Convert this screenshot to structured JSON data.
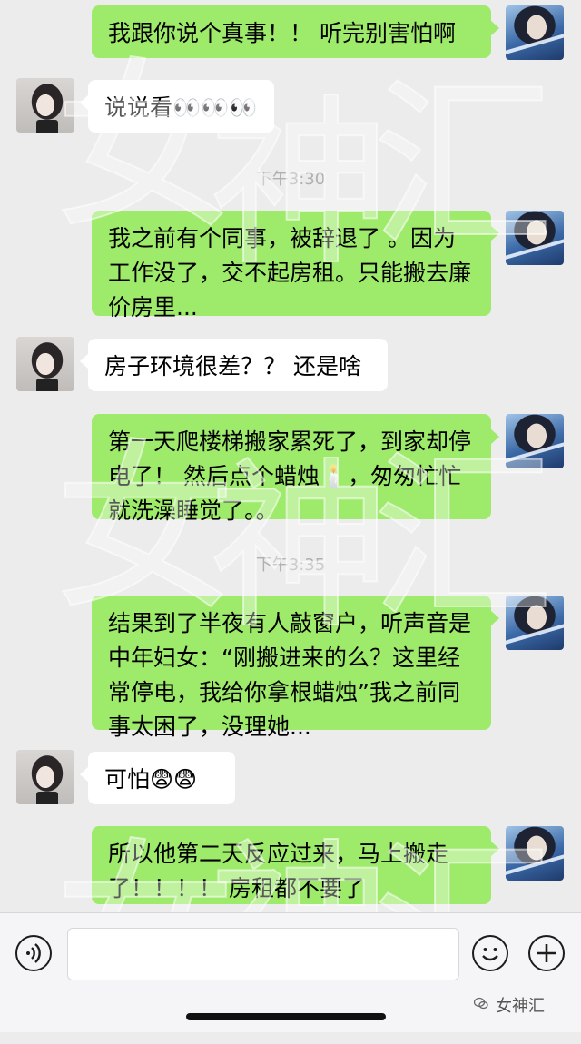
{
  "messages": [
    {
      "side": "me",
      "text": "我跟你说个真事！！ 听完别害怕啊"
    },
    {
      "side": "them",
      "text": "说说看👀👀👀"
    },
    {
      "time": "下午3:30"
    },
    {
      "side": "me",
      "text": "我之前有个同事，被辞退了 。因为工作没了，交不起房租。只能搬去廉价房里..."
    },
    {
      "side": "them",
      "text": "房子环境很差？？ 还是啥"
    },
    {
      "side": "me",
      "text": "第一天爬楼梯搬家累死了，到家却停电了！ 然后点个蜡烛🕯️，匆匆忙忙就洗澡睡觉了。。"
    },
    {
      "time": "下午3:35"
    },
    {
      "side": "me",
      "text": "结果到了半夜有人敲窗户，听声音是中年妇女：“刚搬进来的么？这里经常停电，我给你拿根蜡烛”我之前同事太困了，没理她..."
    },
    {
      "side": "them",
      "text": "可怕😨😨"
    },
    {
      "side": "me",
      "text": "所以他第二天反应过来，马上搬走了！！！！ 房租都不要了"
    }
  ],
  "watermark": {
    "text": "女神汇",
    "brand": "女神汇"
  },
  "toolbar": {
    "voice_icon": "voice-icon",
    "emoji_icon": "emoji-icon",
    "plus_icon": "plus-icon"
  },
  "colors": {
    "my_bubble": "#9eea6a",
    "their_bubble": "#ffffff",
    "background": "#ececec"
  }
}
